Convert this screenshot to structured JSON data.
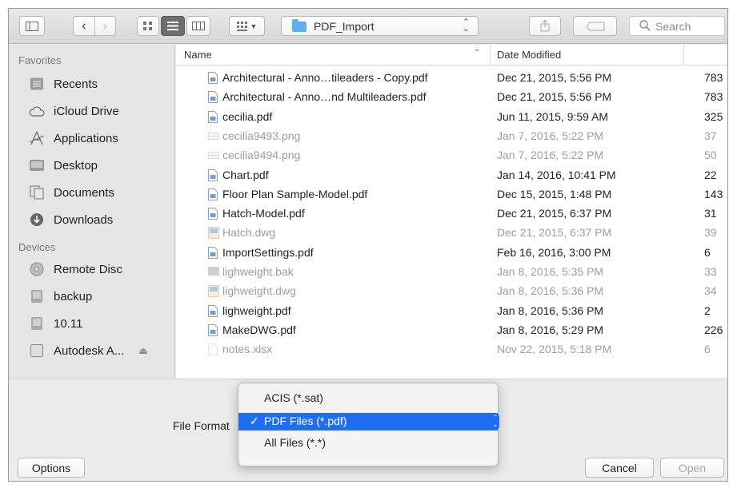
{
  "toolbar": {
    "path_folder": "PDF_Import",
    "search_placeholder": "Search"
  },
  "sidebar": {
    "favorites_title": "Favorites",
    "favorites": [
      {
        "label": "Recents",
        "icon": "recents-icon"
      },
      {
        "label": "iCloud Drive",
        "icon": "cloud-icon"
      },
      {
        "label": "Applications",
        "icon": "applications-icon"
      },
      {
        "label": "Desktop",
        "icon": "desktop-icon"
      },
      {
        "label": "Documents",
        "icon": "documents-icon"
      },
      {
        "label": "Downloads",
        "icon": "downloads-icon"
      }
    ],
    "devices_title": "Devices",
    "devices": [
      {
        "label": "Remote Disc",
        "icon": "disc-icon"
      },
      {
        "label": "backup",
        "icon": "drive-icon"
      },
      {
        "label": "10.11",
        "icon": "drive-icon"
      },
      {
        "label": "Autodesk A...",
        "icon": "volume-icon"
      }
    ]
  },
  "filelist": {
    "col_name": "Name",
    "col_date": "Date Modified",
    "rows": [
      {
        "name": "Architectural - Anno…tileaders - Copy.pdf",
        "date": "Dec 21, 2015, 5:56 PM",
        "size": "783",
        "enabled": true,
        "type": "pdf"
      },
      {
        "name": "Architectural - Anno…nd Multileaders.pdf",
        "date": "Dec 21, 2015, 5:56 PM",
        "size": "783",
        "enabled": true,
        "type": "pdf"
      },
      {
        "name": "cecilia.pdf",
        "date": "Jun 11, 2015, 9:59 AM",
        "size": "325",
        "enabled": true,
        "type": "pdf"
      },
      {
        "name": "cecilia9493.png",
        "date": "Jan 7, 2016, 5:22 PM",
        "size": "37",
        "enabled": false,
        "type": "png"
      },
      {
        "name": "cecilia9494.png",
        "date": "Jan 7, 2016, 5:22 PM",
        "size": "50",
        "enabled": false,
        "type": "png"
      },
      {
        "name": "Chart.pdf",
        "date": "Jan 14, 2016, 10:41 PM",
        "size": "22",
        "enabled": true,
        "type": "pdf"
      },
      {
        "name": "Floor Plan Sample-Model.pdf",
        "date": "Dec 15, 2015, 1:48 PM",
        "size": "143",
        "enabled": true,
        "type": "pdf"
      },
      {
        "name": "Hatch-Model.pdf",
        "date": "Dec 21, 2015, 6:37 PM",
        "size": "31",
        "enabled": true,
        "type": "pdf"
      },
      {
        "name": "Hatch.dwg",
        "date": "Dec 21, 2015, 6:37 PM",
        "size": "39",
        "enabled": false,
        "type": "dwg"
      },
      {
        "name": "ImportSettings.pdf",
        "date": "Feb 16, 2016, 3:00 PM",
        "size": "6",
        "enabled": true,
        "type": "pdf"
      },
      {
        "name": "lighweight.bak",
        "date": "Jan 8, 2016, 5:35 PM",
        "size": "33",
        "enabled": false,
        "type": "bak"
      },
      {
        "name": "lighweight.dwg",
        "date": "Jan 8, 2016, 5:36 PM",
        "size": "34",
        "enabled": false,
        "type": "dwg"
      },
      {
        "name": "lighweight.pdf",
        "date": "Jan 8, 2016, 5:36 PM",
        "size": "2",
        "enabled": true,
        "type": "pdf"
      },
      {
        "name": "MakeDWG.pdf",
        "date": "Jan 8, 2016, 5:29 PM",
        "size": "226",
        "enabled": true,
        "type": "pdf"
      },
      {
        "name": "notes.xlsx",
        "date": "Nov 22, 2015, 5:18 PM",
        "size": "6",
        "enabled": false,
        "type": "xlsx"
      }
    ]
  },
  "bottom": {
    "file_format_label": "File Format",
    "options_label": "Options",
    "cancel_label": "Cancel",
    "open_label": "Open"
  },
  "format_menu": {
    "items": [
      {
        "label": "ACIS (*.sat)",
        "selected": false
      },
      {
        "label": "PDF Files (*.pdf)",
        "selected": true
      },
      {
        "label": "All Files (*.*)",
        "selected": false
      }
    ],
    "check": "✓"
  }
}
